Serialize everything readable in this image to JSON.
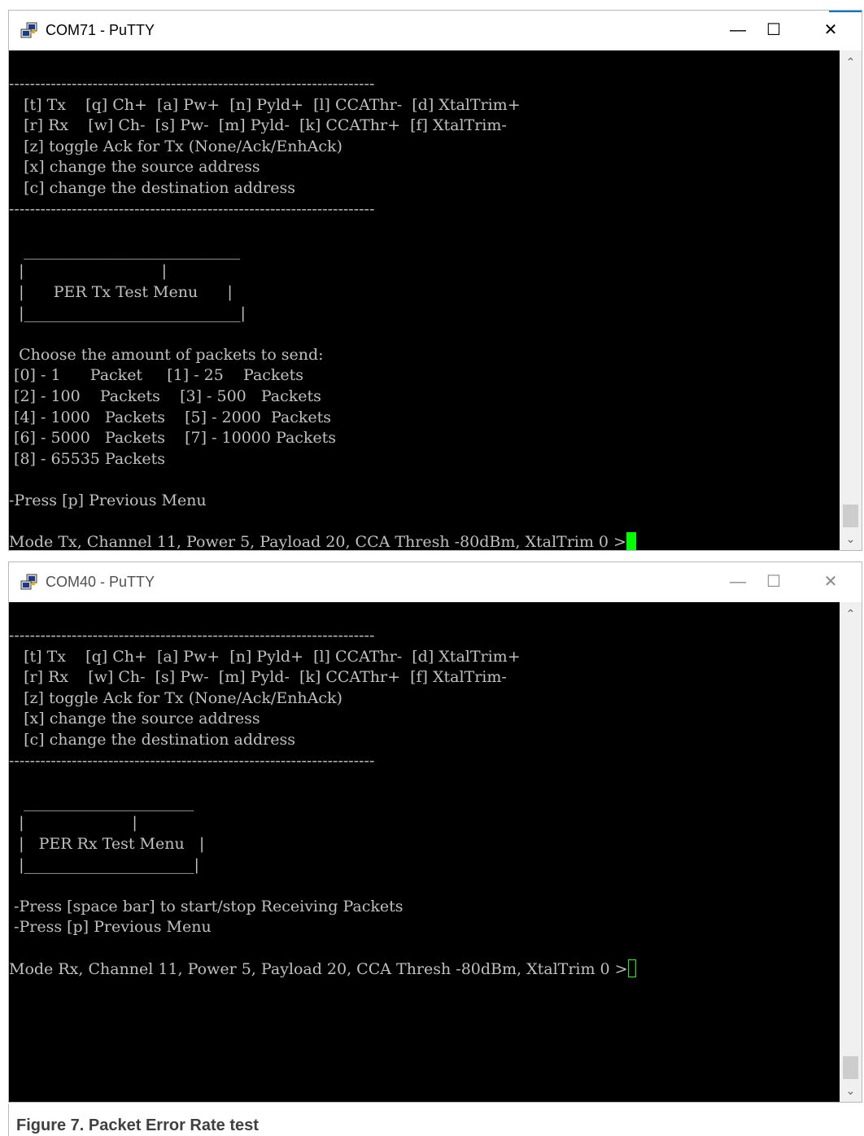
{
  "windows": [
    {
      "title": "COM71 - PuTTY",
      "state": "active",
      "controls": {
        "minimize": "—",
        "maximize": "☐",
        "close": "✕"
      },
      "lines": [
        "----------------------------------------------------------------------",
        "   [t] Tx    [q] Ch+  [a] Pw+  [n] Pyld+  [l] CCAThr-  [d] XtalTrim+",
        "   [r] Rx    [w] Ch-  [s] Pw-  [m] Pyld-  [k] CCAThr+  [f] XtalTrim-",
        "   [z] toggle Ack for Tx (None/Ack/EnhAck)",
        "   [x] change the source address",
        "   [c] change the destination address",
        "----------------------------------------------------------------------",
        "",
        "   ____________________________",
        "  |                            |",
        "  |      PER Tx Test Menu      |",
        "  |____________________________|",
        "",
        "  Choose the amount of packets to send:",
        " [0] - 1      Packet     [1] - 25    Packets",
        " [2] - 100    Packets    [3] - 500   Packets",
        " [4] - 1000   Packets    [5] - 2000  Packets",
        " [6] - 5000   Packets    [7] - 10000 Packets",
        " [8] - 65535 Packets",
        "",
        "-Press [p] Previous Menu",
        "",
        "Mode Tx, Channel 11, Power 5, Payload 20, CCA Thresh -80dBm, XtalTrim 0 >"
      ]
    },
    {
      "title": "COM40 - PuTTY",
      "state": "inactive",
      "controls": {
        "minimize": "—",
        "maximize": "☐",
        "close": "✕"
      },
      "lines": [
        "----------------------------------------------------------------------",
        "   [t] Tx    [q] Ch+  [a] Pw+  [n] Pyld+  [l] CCAThr-  [d] XtalTrim+",
        "   [r] Rx    [w] Ch-  [s] Pw-  [m] Pyld-  [k] CCAThr+  [f] XtalTrim-",
        "   [z] toggle Ack for Tx (None/Ack/EnhAck)",
        "   [x] change the source address",
        "   [c] change the destination address",
        "----------------------------------------------------------------------",
        "",
        "   ______________________",
        "  |                      |",
        "  |   PER Rx Test Menu   |",
        "  |______________________|",
        "",
        " -Press [space bar] to start/stop Receiving Packets",
        " -Press [p] Previous Menu",
        "",
        "Mode Rx, Channel 11, Power 5, Payload 20, CCA Thresh -80dBm, XtalTrim 0 >"
      ]
    }
  ],
  "caption": "Figure 7.  Packet Error Rate test",
  "colors": {
    "terminal_bg": "#000000",
    "terminal_fg": "#c0c0c0",
    "cursor": "#00ff00"
  },
  "icons": {
    "app": "putty-icon",
    "scroll_up": "chevron-up-icon",
    "scroll_down": "chevron-down-icon"
  }
}
